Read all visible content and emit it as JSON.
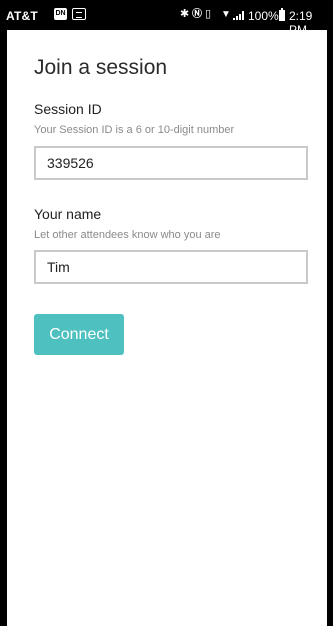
{
  "status_bar": {
    "carrier": "AT&T",
    "badge_dn": "DN",
    "battery_percent": "100%",
    "time": "2:19 PM",
    "icons": [
      "dn-badge-icon",
      "gallery-icon",
      "bluetooth-icon",
      "nfc-icon",
      "vibrate-icon",
      "wifi-icon",
      "signal-icon",
      "battery-icon"
    ]
  },
  "form": {
    "title": "Join a session",
    "session_id": {
      "label": "Session ID",
      "help": "Your Session ID is a 6 or 10-digit number",
      "value": "339526"
    },
    "name": {
      "label": "Your name",
      "help": "Let other attendees know who you are",
      "value": "Tim"
    },
    "connect_label": "Connect"
  },
  "colors": {
    "accent": "#4ec0c0",
    "background": "#ffffff",
    "status_bar": "#000000",
    "input_border": "#c9c9c9",
    "help_text": "#8a8a8a"
  }
}
